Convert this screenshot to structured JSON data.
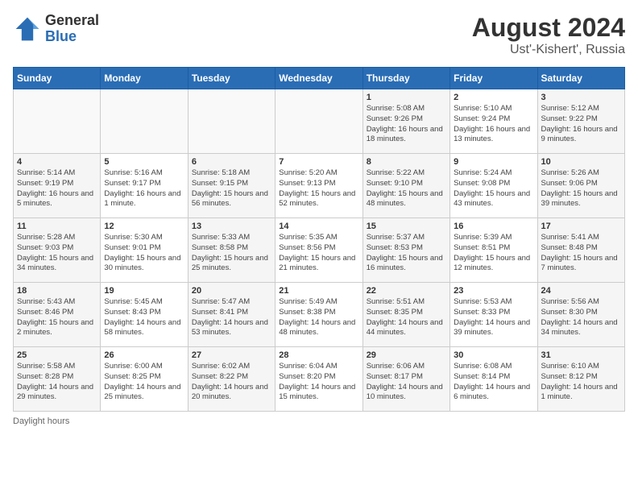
{
  "header": {
    "logo_general": "General",
    "logo_blue": "Blue",
    "month_year": "August 2024",
    "location": "Ust'-Kishert', Russia"
  },
  "weekdays": [
    "Sunday",
    "Monday",
    "Tuesday",
    "Wednesday",
    "Thursday",
    "Friday",
    "Saturday"
  ],
  "weeks": [
    [
      {
        "day": "",
        "info": ""
      },
      {
        "day": "",
        "info": ""
      },
      {
        "day": "",
        "info": ""
      },
      {
        "day": "",
        "info": ""
      },
      {
        "day": "1",
        "info": "Sunrise: 5:08 AM\nSunset: 9:26 PM\nDaylight: 16 hours and 18 minutes."
      },
      {
        "day": "2",
        "info": "Sunrise: 5:10 AM\nSunset: 9:24 PM\nDaylight: 16 hours and 13 minutes."
      },
      {
        "day": "3",
        "info": "Sunrise: 5:12 AM\nSunset: 9:22 PM\nDaylight: 16 hours and 9 minutes."
      }
    ],
    [
      {
        "day": "4",
        "info": "Sunrise: 5:14 AM\nSunset: 9:19 PM\nDaylight: 16 hours and 5 minutes."
      },
      {
        "day": "5",
        "info": "Sunrise: 5:16 AM\nSunset: 9:17 PM\nDaylight: 16 hours and 1 minute."
      },
      {
        "day": "6",
        "info": "Sunrise: 5:18 AM\nSunset: 9:15 PM\nDaylight: 15 hours and 56 minutes."
      },
      {
        "day": "7",
        "info": "Sunrise: 5:20 AM\nSunset: 9:13 PM\nDaylight: 15 hours and 52 minutes."
      },
      {
        "day": "8",
        "info": "Sunrise: 5:22 AM\nSunset: 9:10 PM\nDaylight: 15 hours and 48 minutes."
      },
      {
        "day": "9",
        "info": "Sunrise: 5:24 AM\nSunset: 9:08 PM\nDaylight: 15 hours and 43 minutes."
      },
      {
        "day": "10",
        "info": "Sunrise: 5:26 AM\nSunset: 9:06 PM\nDaylight: 15 hours and 39 minutes."
      }
    ],
    [
      {
        "day": "11",
        "info": "Sunrise: 5:28 AM\nSunset: 9:03 PM\nDaylight: 15 hours and 34 minutes."
      },
      {
        "day": "12",
        "info": "Sunrise: 5:30 AM\nSunset: 9:01 PM\nDaylight: 15 hours and 30 minutes."
      },
      {
        "day": "13",
        "info": "Sunrise: 5:33 AM\nSunset: 8:58 PM\nDaylight: 15 hours and 25 minutes."
      },
      {
        "day": "14",
        "info": "Sunrise: 5:35 AM\nSunset: 8:56 PM\nDaylight: 15 hours and 21 minutes."
      },
      {
        "day": "15",
        "info": "Sunrise: 5:37 AM\nSunset: 8:53 PM\nDaylight: 15 hours and 16 minutes."
      },
      {
        "day": "16",
        "info": "Sunrise: 5:39 AM\nSunset: 8:51 PM\nDaylight: 15 hours and 12 minutes."
      },
      {
        "day": "17",
        "info": "Sunrise: 5:41 AM\nSunset: 8:48 PM\nDaylight: 15 hours and 7 minutes."
      }
    ],
    [
      {
        "day": "18",
        "info": "Sunrise: 5:43 AM\nSunset: 8:46 PM\nDaylight: 15 hours and 2 minutes."
      },
      {
        "day": "19",
        "info": "Sunrise: 5:45 AM\nSunset: 8:43 PM\nDaylight: 14 hours and 58 minutes."
      },
      {
        "day": "20",
        "info": "Sunrise: 5:47 AM\nSunset: 8:41 PM\nDaylight: 14 hours and 53 minutes."
      },
      {
        "day": "21",
        "info": "Sunrise: 5:49 AM\nSunset: 8:38 PM\nDaylight: 14 hours and 48 minutes."
      },
      {
        "day": "22",
        "info": "Sunrise: 5:51 AM\nSunset: 8:35 PM\nDaylight: 14 hours and 44 minutes."
      },
      {
        "day": "23",
        "info": "Sunrise: 5:53 AM\nSunset: 8:33 PM\nDaylight: 14 hours and 39 minutes."
      },
      {
        "day": "24",
        "info": "Sunrise: 5:56 AM\nSunset: 8:30 PM\nDaylight: 14 hours and 34 minutes."
      }
    ],
    [
      {
        "day": "25",
        "info": "Sunrise: 5:58 AM\nSunset: 8:28 PM\nDaylight: 14 hours and 29 minutes."
      },
      {
        "day": "26",
        "info": "Sunrise: 6:00 AM\nSunset: 8:25 PM\nDaylight: 14 hours and 25 minutes."
      },
      {
        "day": "27",
        "info": "Sunrise: 6:02 AM\nSunset: 8:22 PM\nDaylight: 14 hours and 20 minutes."
      },
      {
        "day": "28",
        "info": "Sunrise: 6:04 AM\nSunset: 8:20 PM\nDaylight: 14 hours and 15 minutes."
      },
      {
        "day": "29",
        "info": "Sunrise: 6:06 AM\nSunset: 8:17 PM\nDaylight: 14 hours and 10 minutes."
      },
      {
        "day": "30",
        "info": "Sunrise: 6:08 AM\nSunset: 8:14 PM\nDaylight: 14 hours and 6 minutes."
      },
      {
        "day": "31",
        "info": "Sunrise: 6:10 AM\nSunset: 8:12 PM\nDaylight: 14 hours and 1 minute."
      }
    ]
  ],
  "footer": {
    "label": "Daylight hours"
  }
}
